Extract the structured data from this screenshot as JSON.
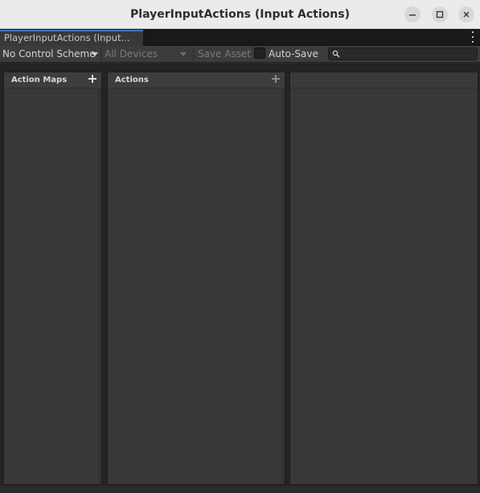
{
  "window": {
    "title": "PlayerInputActions (Input Actions)"
  },
  "tab": {
    "label": "PlayerInputActions (Input..."
  },
  "toolbar": {
    "control_scheme": "No Control Scheme",
    "devices": "All Devices",
    "save_asset": "Save Asset",
    "auto_save": "Auto-Save",
    "auto_save_checked": false,
    "search_value": "",
    "search_placeholder": ""
  },
  "panels": {
    "action_maps": {
      "title": "Action Maps",
      "add_icon": "plus-icon"
    },
    "actions": {
      "title": "Actions",
      "add_icon": "plus-icon"
    },
    "properties": {
      "title": ""
    }
  },
  "colors": {
    "accent": "#3a79bb",
    "panel_bg": "#383838",
    "toolbar_bg": "#3c3c3c",
    "titlebar_bg": "#ebebeb"
  }
}
